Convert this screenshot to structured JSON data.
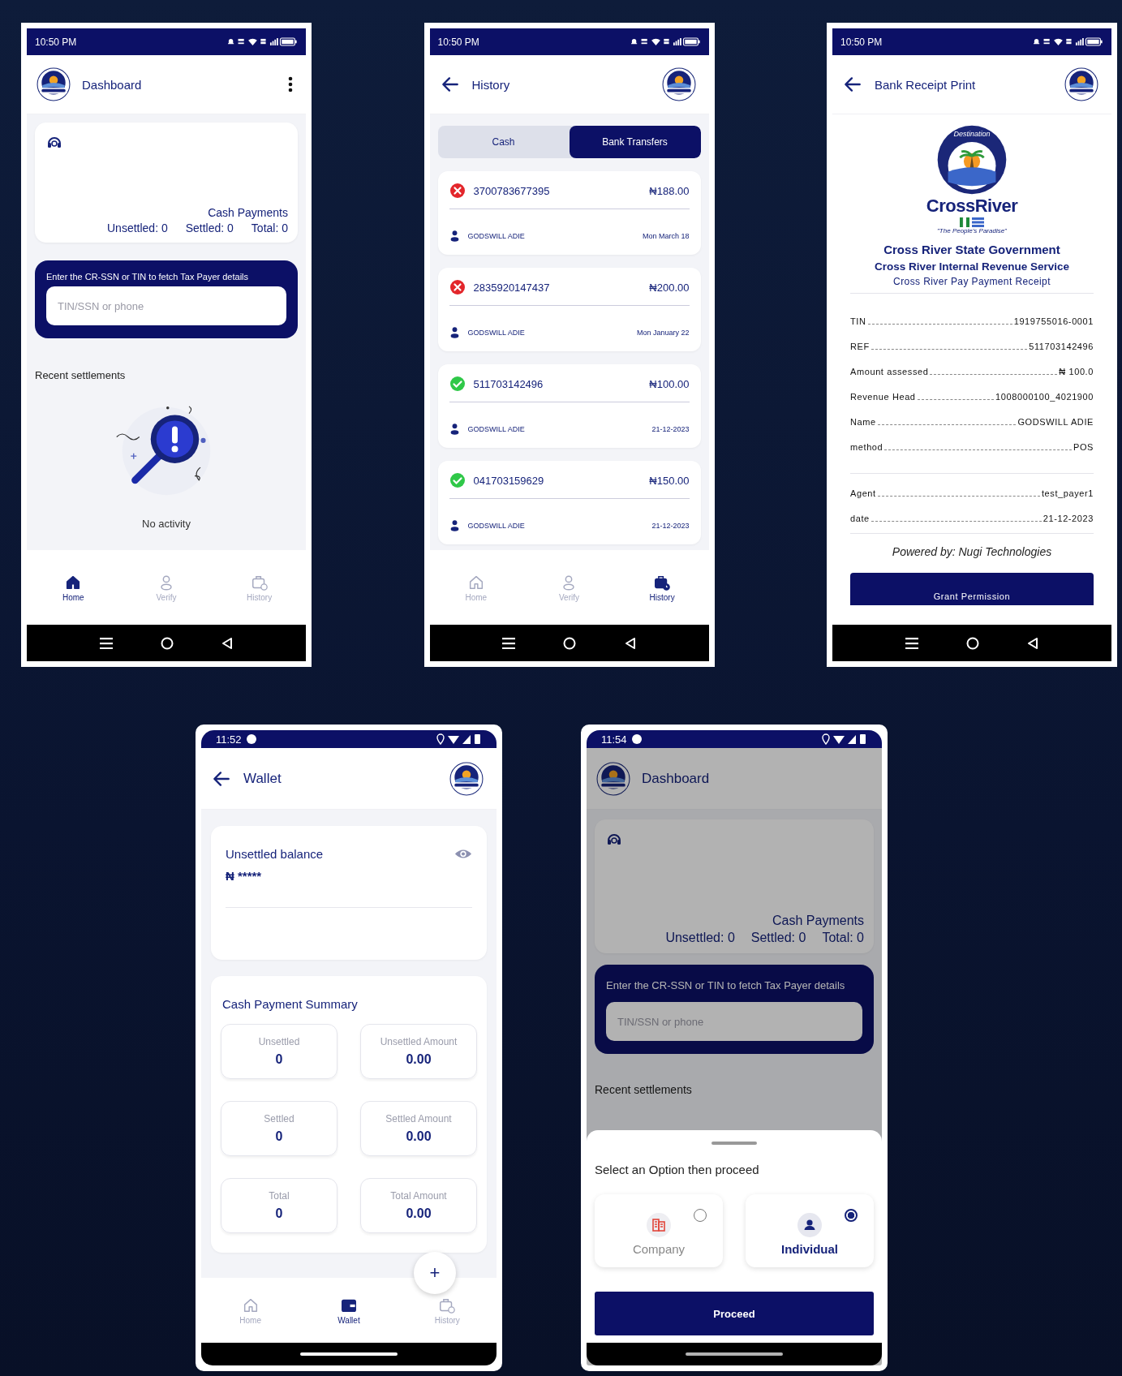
{
  "screens": [
    {
      "kind": "dashboard",
      "status_bar": {
        "kind": "classic",
        "time": "10:50 PM"
      },
      "app_bar": {
        "title": "Dashboard",
        "back": false,
        "menu": true
      },
      "summary_card": {
        "title": "Cash Payments",
        "stats": [
          "Unsettled: 0",
          "Settled: 0",
          "Total: 0"
        ]
      },
      "lookup": {
        "label": "Enter the CR-SSN or TIN to fetch Tax Payer details",
        "placeholder": "TIN/SSN or phone"
      },
      "recent_heading": "Recent settlements",
      "empty_text": "No activity",
      "nav": [
        {
          "kind": "home",
          "label": "Home",
          "selected": true
        },
        {
          "kind": "verify",
          "label": "Verify",
          "selected": false
        },
        {
          "kind": "history",
          "label": "History",
          "selected": false
        }
      ],
      "system_nav": {
        "kind": "buttons"
      }
    },
    {
      "kind": "history",
      "status_bar": {
        "kind": "classic",
        "time": "10:50 PM"
      },
      "app_bar": {
        "title": "History",
        "back": true,
        "menu": false
      },
      "tabs": [
        {
          "label": "Cash",
          "selected": false
        },
        {
          "label": "Bank Transfers",
          "selected": true
        }
      ],
      "transactions": [
        {
          "kind": "failed",
          "ref": "3700783677395",
          "amount": "₦188.00",
          "name": "GODSWILL ADIE",
          "date": "Mon March 18"
        },
        {
          "kind": "failed",
          "ref": "2835920147437",
          "amount": "₦200.00",
          "name": "GODSWILL ADIE",
          "date": "Mon January 22"
        },
        {
          "kind": "success",
          "ref": "511703142496",
          "amount": "₦100.00",
          "name": "GODSWILL ADIE",
          "date": "21-12-2023"
        },
        {
          "kind": "success",
          "ref": "041703159629",
          "amount": "₦150.00",
          "name": "GODSWILL ADIE",
          "date": "21-12-2023"
        }
      ],
      "nav": [
        {
          "kind": "home",
          "label": "Home",
          "selected": false
        },
        {
          "kind": "verify",
          "label": "Verify",
          "selected": false
        },
        {
          "kind": "history",
          "label": "History",
          "selected": true
        }
      ],
      "system_nav": {
        "kind": "buttons"
      }
    },
    {
      "kind": "receipt",
      "status_bar": {
        "kind": "classic",
        "time": "10:50 PM"
      },
      "app_bar": {
        "title": "Bank Receipt Print",
        "back": true,
        "menu": false
      },
      "logo": {
        "arc": "Destination",
        "wordmark": "CrossRiver",
        "tagline": "\"The People's Paradise\""
      },
      "headings": [
        "Cross River State Government",
        "Cross River Internal Revenue Service",
        "Cross River Pay Payment Receipt"
      ],
      "fields": [
        {
          "label": "TIN",
          "value": "1919755016-0001"
        },
        {
          "label": "REF",
          "value": "511703142496"
        },
        {
          "label": "Amount assessed",
          "value": "₦ 100.0"
        },
        {
          "label": "Revenue Head",
          "value": "1008000100_4021900"
        },
        {
          "label": "Name",
          "value": "GODSWILL ADIE"
        },
        {
          "label": "method",
          "value": "POS"
        }
      ],
      "agent_fields": [
        {
          "label": "Agent",
          "value": "test_payer1"
        },
        {
          "label": "date",
          "value": "21-12-2023"
        }
      ],
      "powered_by": "Powered by: Nugi Technologies",
      "button": "Grant Permission",
      "system_nav": {
        "kind": "buttons"
      }
    },
    {
      "kind": "wallet",
      "status_bar": {
        "kind": "gesture",
        "time": "11:52"
      },
      "app_bar": {
        "title": "Wallet",
        "back": true,
        "menu": false
      },
      "balance": {
        "label": "Unsettled balance",
        "value": "₦ *****"
      },
      "summary": {
        "title": "Cash Payment Summary",
        "tiles": [
          {
            "label": "Unsettled",
            "value": "0"
          },
          {
            "label": "Unsettled Amount",
            "value": "0.00"
          },
          {
            "label": "Settled",
            "value": "0"
          },
          {
            "label": "Settled Amount",
            "value": "0.00"
          },
          {
            "label": "Total",
            "value": "0"
          },
          {
            "label": "Total Amount",
            "value": "0.00"
          }
        ]
      },
      "fab": "+",
      "nav": [
        {
          "kind": "home",
          "label": "Home",
          "selected": false
        },
        {
          "kind": "wallet",
          "label": "Wallet",
          "selected": true
        },
        {
          "kind": "history",
          "label": "History",
          "selected": false
        }
      ],
      "system_nav": {
        "kind": "gesture"
      }
    },
    {
      "kind": "dashboard",
      "status_bar": {
        "kind": "gesture",
        "time": "11:54"
      },
      "app_bar": {
        "title": "Dashboard",
        "back": false,
        "menu": false
      },
      "summary_card": {
        "title": "Cash Payments",
        "stats": [
          "Unsettled: 0",
          "Settled: 0",
          "Total: 0"
        ]
      },
      "lookup": {
        "label": "Enter the CR-SSN or TIN to fetch Tax Payer details",
        "placeholder": "TIN/SSN or phone"
      },
      "recent_heading": "Recent settlements",
      "sheet": {
        "title": "Select an Option then proceed",
        "options": [
          {
            "kind": "company",
            "label": "Company",
            "selected": false
          },
          {
            "kind": "individual",
            "label": "Individual",
            "selected": true
          }
        ],
        "button": "Proceed"
      },
      "system_nav": {
        "kind": "gesture"
      }
    }
  ]
}
